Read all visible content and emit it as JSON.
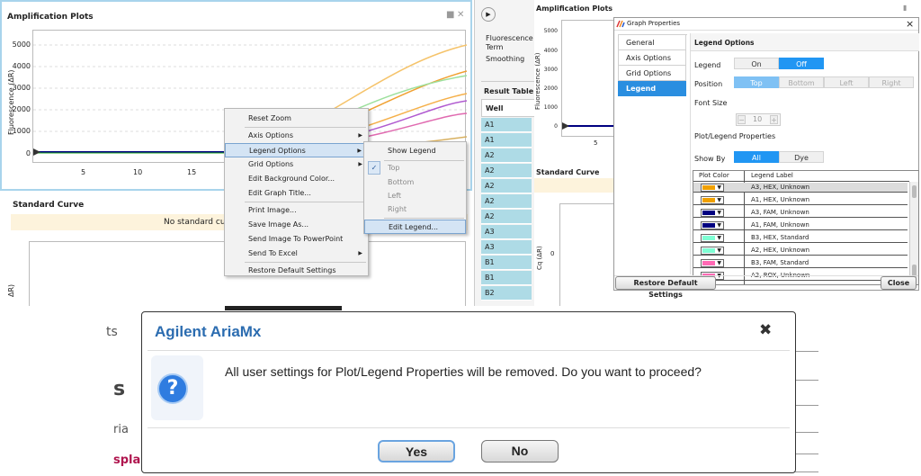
{
  "panel1": {
    "title": "Amplification Plots",
    "y_axis_label": "Fluorescence (ΔR)",
    "y_ticks": [
      "5000",
      "4000",
      "3000",
      "2000",
      "1000",
      "0"
    ],
    "x_ticks": [
      "5",
      "10",
      "15"
    ],
    "standard_curve_title": "Standard Curve",
    "no_curve_text": "No standard cu",
    "y_axis_label_clipped": "ΔR)"
  },
  "context_menu": {
    "items": [
      {
        "label": "Reset Zoom",
        "arrow": false,
        "separator_after": true
      },
      {
        "label": "Axis Options",
        "arrow": true,
        "separator_after": false
      },
      {
        "label": "Legend Options",
        "arrow": true,
        "separator_after": false,
        "selected": true
      },
      {
        "label": "Grid Options",
        "arrow": true,
        "separator_after": false
      },
      {
        "label": "Edit Background Color...",
        "arrow": false,
        "separator_after": false
      },
      {
        "label": "Edit Graph Title...",
        "arrow": false,
        "separator_after": true
      },
      {
        "label": "Print Image...",
        "arrow": false,
        "separator_after": false
      },
      {
        "label": "Save Image As...",
        "arrow": false,
        "separator_after": false
      },
      {
        "label": "Send Image To PowerPoint",
        "arrow": false,
        "separator_after": false
      },
      {
        "label": "Send To Excel",
        "arrow": true,
        "separator_after": true
      },
      {
        "label": "Restore Default Settings",
        "arrow": false,
        "separator_after": false
      }
    ],
    "submenu": {
      "show_legend": "Show Legend",
      "check": "✓",
      "top": "Top",
      "bottom": "Bottom",
      "left": "Left",
      "right": "Right",
      "edit_legend": "Edit Legend..."
    }
  },
  "panel2": {
    "fluorescence_term": "Fluorescence Term",
    "smoothing": "Smoothing",
    "result_table": "Result Table",
    "well_header": "Well",
    "wells": [
      "A1",
      "A1",
      "A2",
      "A2",
      "A2",
      "A2",
      "A2",
      "A3",
      "A3",
      "B1",
      "B1",
      "B2"
    ]
  },
  "panel3": {
    "title": "Amplification Plots",
    "dialog_title": "Graph Properties",
    "close_x": "×",
    "nav": [
      "General",
      "Axis Options",
      "Grid Options",
      "Legend Options"
    ],
    "active_nav": "Legend Options",
    "legend_options_header": "Legend Options",
    "legend_label": "Legend",
    "legend_on": "On",
    "legend_off": "Off",
    "position_label": "Position",
    "positions": [
      "Top",
      "Bottom",
      "Left",
      "Right"
    ],
    "font_size_label": "Font Size",
    "font_size_value": "10",
    "font_minus": "−",
    "font_plus": "+",
    "plot_legend_props": "Plot/Legend Properties",
    "show_by_label": "Show By",
    "show_by_all": "All",
    "show_by_dye": "Dye",
    "table_header_color": "Plot Color",
    "table_header_label": "Legend Label",
    "rows": [
      {
        "color": "#f0a000",
        "label": "A3, HEX, Unknown"
      },
      {
        "color": "#f0a000",
        "label": "A1, HEX, Unknown"
      },
      {
        "color": "#000080",
        "label": "A3, FAM, Unknown"
      },
      {
        "color": "#000080",
        "label": "A1, FAM, Unknown"
      },
      {
        "color": "#7fffd4",
        "label": "B3, HEX, Standard"
      },
      {
        "color": "#7fffd4",
        "label": "A2, HEX, Unknown"
      },
      {
        "color": "#ff69b4",
        "label": "B3, FAM, Standard"
      },
      {
        "color": "#ff69b4",
        "label": "A2, ROX, Unknown"
      }
    ],
    "restore_button": "Restore Default Settings",
    "close_button": "Close",
    "y_axis_label": "Fluorescence (ΔR)",
    "y_ticks": [
      "5000",
      "4000",
      "3000",
      "2000",
      "1000",
      "0"
    ],
    "x_tick": "5",
    "standard_curve_title": "Standard Curve",
    "cq_label": "Cq (ΔR)",
    "cq_zero": "0"
  },
  "bottom": {
    "bg_text_ts": "ts",
    "bg_text_s": "s",
    "bg_text_ria": "ria",
    "bg_text_spla": "spla",
    "dialog_title": "Agilent AriaMx",
    "close_icon": "✖",
    "question_mark": "?",
    "message": "All user settings for Plot/Legend Properties will be removed. Do you want to proceed?",
    "yes_label": "Yes",
    "no_label": "No"
  },
  "colors": {
    "accent_blue": "#2196f3",
    "title_blue": "#2b6cb0",
    "well_cell": "#aedbe6"
  }
}
